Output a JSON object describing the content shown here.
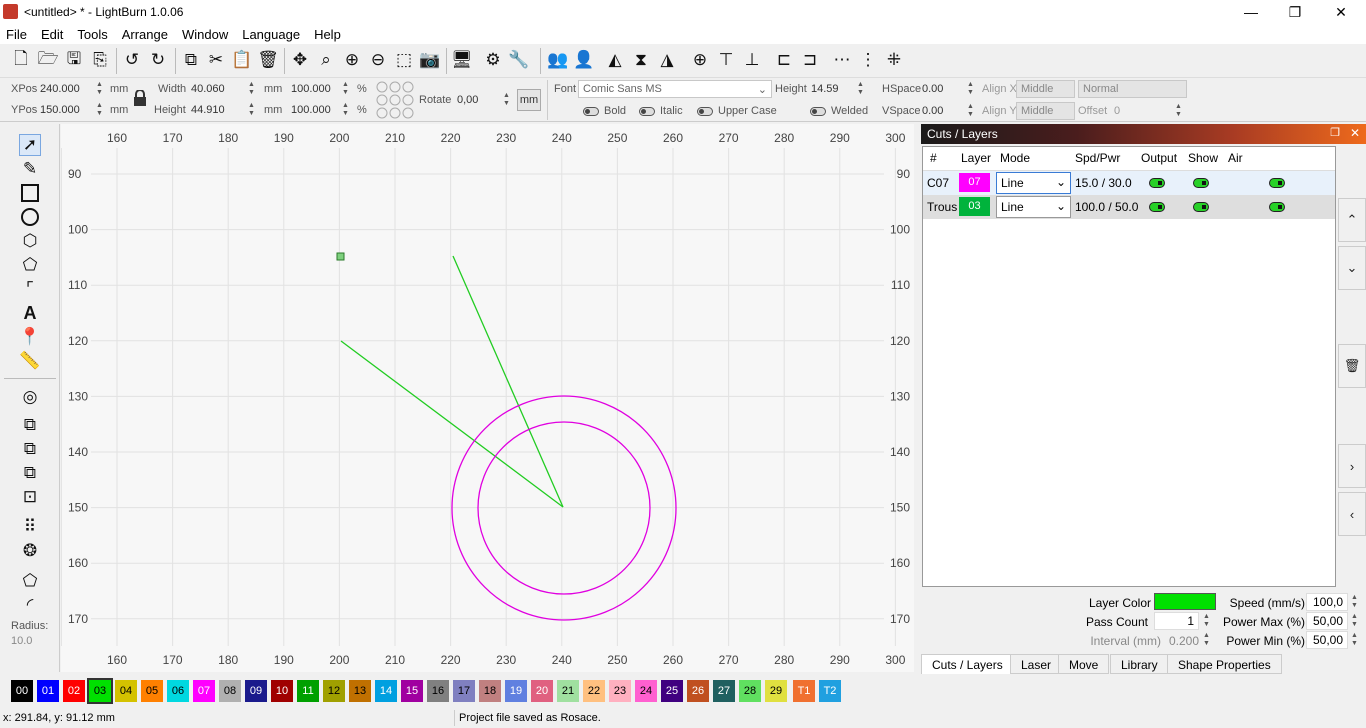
{
  "window": {
    "title": "<untitled> * - LightBurn 1.0.06",
    "minimize": "—",
    "restore": "❐",
    "close": "✕"
  },
  "menu": [
    "File",
    "Edit",
    "Tools",
    "Arrange",
    "Window",
    "Language",
    "Help"
  ],
  "props": {
    "xpos_label": "XPos",
    "xpos": "240.000",
    "ypos_label": "YPos",
    "ypos": "150.000",
    "unit": "mm",
    "width_label": "Width",
    "width": "40.060",
    "height_label": "Height",
    "height": "44.910",
    "scale_w": "100.000",
    "scale_h": "100.000",
    "percent": "%",
    "rotate_label": "Rotate",
    "rotate": "0,00",
    "mm_button": "mm",
    "font_label": "Font",
    "font": "Comic Sans MS",
    "fheight_label": "Height",
    "fheight": "14.59",
    "hspace_label": "HSpace",
    "hspace": "0.00",
    "vspace_label": "VSpace",
    "vspace": "0.00",
    "alignx_label": "Align X",
    "alignx": "Middle",
    "aligny_label": "Align Y",
    "aligny": "Middle",
    "normal": "Normal",
    "offset_label": "Offset",
    "offset": "0",
    "bold": "Bold",
    "italic": "Italic",
    "upper": "Upper Case",
    "welded": "Welded"
  },
  "left_tools": {
    "radius_label": "Radius:",
    "radius": "10.0"
  },
  "canvas": {
    "x_ticks": [
      "160",
      "170",
      "180",
      "190",
      "200",
      "210",
      "220",
      "230",
      "240",
      "250",
      "260",
      "270",
      "280",
      "290",
      "300"
    ],
    "y_ticks": [
      "90",
      "100",
      "110",
      "120",
      "130",
      "140",
      "150",
      "160",
      "170"
    ]
  },
  "cuts": {
    "title": "Cuts / Layers",
    "headers": [
      "#",
      "Layer",
      "Mode",
      "Spd/Pwr",
      "Output",
      "Show",
      "Air"
    ],
    "rows": [
      {
        "num": "C07",
        "layer": "07",
        "color": "#ff00ff",
        "mode": "Line",
        "spdpwr": "15.0 / 30.0"
      },
      {
        "num": "Trous",
        "layer": "03",
        "color": "#00b33c",
        "mode": "Line",
        "spdpwr": "100.0 / 50.0"
      }
    ]
  },
  "layer_props": {
    "color_label": "Layer Color",
    "color": "#00e000",
    "pass_label": "Pass Count",
    "pass": "1",
    "interval_label": "Interval (mm)",
    "interval": "0.200",
    "speed_label": "Speed (mm/s)",
    "speed": "100,0",
    "pmax_label": "Power Max (%)",
    "pmax": "50,00",
    "pmin_label": "Power Min (%)",
    "pmin": "50,00"
  },
  "tabs": [
    "Cuts / Layers",
    "Laser",
    "Move",
    "Library",
    "Shape Properties"
  ],
  "palette": [
    {
      "l": "00",
      "c": "#000000",
      "t": "#fff"
    },
    {
      "l": "01",
      "c": "#0000ff",
      "t": "#fff"
    },
    {
      "l": "02",
      "c": "#ff0000",
      "t": "#fff"
    },
    {
      "l": "03",
      "c": "#00e000",
      "t": "#000"
    },
    {
      "l": "04",
      "c": "#d4c200",
      "t": "#000"
    },
    {
      "l": "05",
      "c": "#ff8000",
      "t": "#000"
    },
    {
      "l": "06",
      "c": "#00d8e0",
      "t": "#000"
    },
    {
      "l": "07",
      "c": "#ff00ff",
      "t": "#fff"
    },
    {
      "l": "08",
      "c": "#b0b0b0",
      "t": "#000"
    },
    {
      "l": "09",
      "c": "#1a1a8c",
      "t": "#fff"
    },
    {
      "l": "10",
      "c": "#a00000",
      "t": "#fff"
    },
    {
      "l": "11",
      "c": "#00a000",
      "t": "#fff"
    },
    {
      "l": "12",
      "c": "#a0a000",
      "t": "#000"
    },
    {
      "l": "13",
      "c": "#c07000",
      "t": "#000"
    },
    {
      "l": "14",
      "c": "#00a0e0",
      "t": "#fff"
    },
    {
      "l": "15",
      "c": "#a000a0",
      "t": "#fff"
    },
    {
      "l": "16",
      "c": "#808080",
      "t": "#000"
    },
    {
      "l": "17",
      "c": "#8080c0",
      "t": "#000"
    },
    {
      "l": "18",
      "c": "#c08080",
      "t": "#000"
    },
    {
      "l": "19",
      "c": "#6080e0",
      "t": "#fff"
    },
    {
      "l": "20",
      "c": "#e06080",
      "t": "#fff"
    },
    {
      "l": "21",
      "c": "#a0e0a0",
      "t": "#000"
    },
    {
      "l": "22",
      "c": "#ffc080",
      "t": "#000"
    },
    {
      "l": "23",
      "c": "#ffb0c0",
      "t": "#000"
    },
    {
      "l": "24",
      "c": "#ff60d0",
      "t": "#000"
    },
    {
      "l": "25",
      "c": "#400080",
      "t": "#fff"
    },
    {
      "l": "26",
      "c": "#c05020",
      "t": "#fff"
    },
    {
      "l": "27",
      "c": "#206060",
      "t": "#fff"
    },
    {
      "l": "28",
      "c": "#60e060",
      "t": "#000"
    },
    {
      "l": "29",
      "c": "#e0e040",
      "t": "#000"
    },
    {
      "l": "T1",
      "c": "#f07030",
      "t": "#fff"
    },
    {
      "l": "T2",
      "c": "#20a0e0",
      "t": "#fff"
    }
  ],
  "status": {
    "coords": "x: 291.84, y: 91.12 mm",
    "message": "Project file saved as Rosace."
  }
}
